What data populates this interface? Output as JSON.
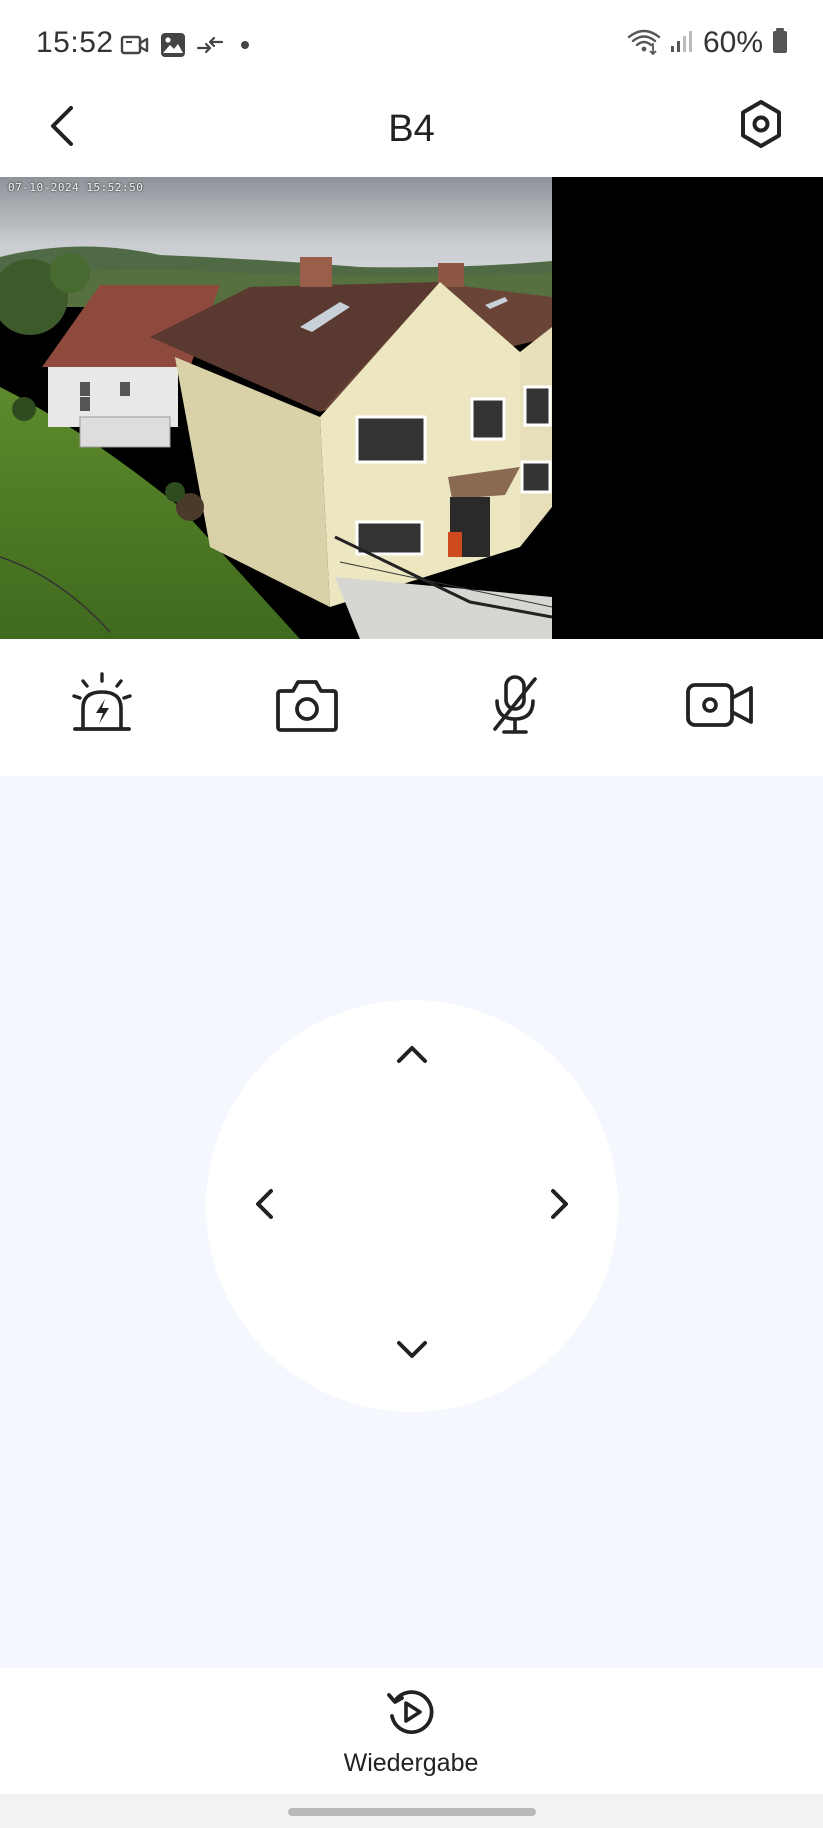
{
  "status_bar": {
    "time": "15:52",
    "battery": "60%",
    "left_icons": [
      "video-notification-icon",
      "gallery-notification-icon",
      "data-transfer-icon",
      "dot-icon"
    ],
    "right_icons": [
      "wifi-icon",
      "signal-icon",
      "battery-icon"
    ]
  },
  "header": {
    "title": "B4"
  },
  "video": {
    "timestamp": "07-10-2024  15:52:50"
  },
  "controls": {
    "items": [
      "siren-icon",
      "snapshot-camera-icon",
      "microphone-muted-icon",
      "record-video-icon"
    ]
  },
  "ptz": {
    "directions": [
      "up",
      "left",
      "right",
      "down"
    ]
  },
  "bottom": {
    "playback_label": "Wiedergabe"
  },
  "colors": {
    "ptz_background": "#f4f7fd",
    "icon": "#222222",
    "video_letterbox": "#000000"
  }
}
